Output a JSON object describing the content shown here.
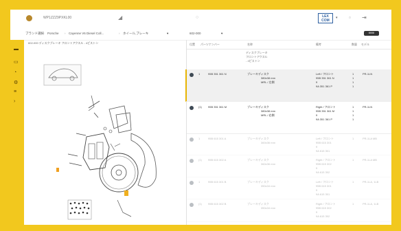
{
  "topbar": {
    "vin": "WP1ZZZ9PXKL00",
    "brand_label": "LEX COM",
    "brand_caret": "▾"
  },
  "breadcrumb": [
    "ブランド選択",
    "Porsche",
    "Cayenne V6 Diesel Coll...",
    "ホイール,ブレーキ",
    "602-000"
  ],
  "toggle_label": "IIIIIIIII",
  "diagram_title": "602-000 ディスクブレーキ フロントアクスル - 4ピストン",
  "table": {
    "headers": [
      "位置",
      "パーツナンバー",
      "名称",
      "備考",
      "数量",
      "モデル"
    ],
    "header_desc": [
      "ディスクブレーキ",
      "フロントアクスル",
      "- 4ピストン"
    ],
    "rows": [
      {
        "pos": "1",
        "part": "95B 351 361 N",
        "name": [
          "ブレーキディスク",
          "380x38 mm",
          "MRL / 左側"
        ],
        "note": [
          "Left / フロント",
          "95B 351 361 N",
          "9",
          "9A 351 361 P"
        ],
        "qty": [
          "1",
          "1",
          "1",
          "1"
        ],
        "model": "PR-1LN",
        "state": "selected"
      },
      {
        "pos": "(1)",
        "part": "95B 351 361 M",
        "name": [
          "ブレーキディスク",
          "380x38 mm",
          "MRL / 右側"
        ],
        "note": [
          "Right / フロント",
          "95B 351 361 M",
          "9",
          "9A 351 361 P"
        ],
        "qty": [
          "1",
          "1",
          "1",
          "1"
        ],
        "model": "PR-1LN",
        "state": "normal"
      },
      {
        "pos": "1",
        "part": "95B 615 301 A",
        "name": [
          "ブレーキディスク",
          "360x36 mm",
          ""
        ],
        "note": [
          "Left / フロント",
          "95B 615 301",
          "9",
          "9A 615 301"
        ],
        "qty": [
          "1",
          "",
          "",
          ""
        ],
        "model": "PR-1LA MB",
        "state": "faded"
      },
      {
        "pos": "(1)",
        "part": "95B 615 302 A",
        "name": [
          "ブレーキディスク",
          "360x36 mm",
          ""
        ],
        "note": [
          "Right / フロント",
          "95B 615 302",
          "9",
          "9A 615 302"
        ],
        "qty": [
          "1",
          "",
          "",
          ""
        ],
        "model": "PR-1LA MB",
        "state": "faded"
      },
      {
        "pos": "1",
        "part": "95B 615 301 B",
        "name": [
          "ブレーキディスク",
          "350x34 mm",
          ""
        ],
        "note": [
          "Left / フロント",
          "95B 615 301",
          "9",
          "9A 615 301"
        ],
        "qty": [
          "1",
          "",
          "",
          ""
        ],
        "model": "PR-1LA, 1LB",
        "state": "faded"
      },
      {
        "pos": "(1)",
        "part": "95B 615 302 B",
        "name": [
          "ブレーキディスク",
          "350x34 mm",
          ""
        ],
        "note": [
          "Right / フロント",
          "95B 615 302",
          "9",
          "9A 615 302"
        ],
        "qty": [
          "1",
          "",
          "",
          ""
        ],
        "model": "PR-1LA, 1LB",
        "state": "faded"
      }
    ]
  },
  "colors": {
    "accent": "#f2c81e",
    "selected_border": "#e7b400"
  }
}
